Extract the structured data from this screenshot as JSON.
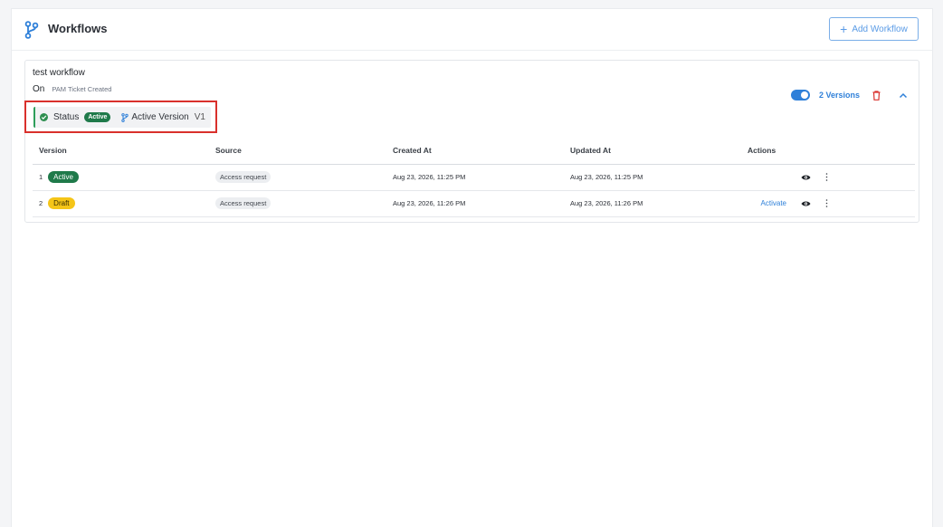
{
  "header": {
    "title": "Workflows",
    "add_button": "Add Workflow",
    "add_icon": "+",
    "icon": "branch-icon"
  },
  "workflow": {
    "name": "test workflow",
    "state": "On",
    "trigger": "PAM Ticket Created",
    "status_label": "Status",
    "status_value": "Active",
    "active_version_label": "Active Version",
    "active_version_value": "V1",
    "versions_link": "2 Versions",
    "toggle_on": true
  },
  "table": {
    "columns": [
      "Version",
      "Source",
      "Created At",
      "Updated At",
      "Actions"
    ],
    "rows": [
      {
        "num": "1",
        "status": "Active",
        "source": "Access request",
        "created": "Aug 23, 2026, 11:25 PM",
        "updated": "Aug 23, 2026, 11:25 PM",
        "action": ""
      },
      {
        "num": "2",
        "status": "Draft",
        "source": "Access request",
        "created": "Aug 23, 2026, 11:26 PM",
        "updated": "Aug 23, 2026, 11:26 PM",
        "action": "Activate"
      }
    ]
  },
  "colors": {
    "accent": "#2f80d9",
    "active_green": "#1f7a4a",
    "draft_yellow": "#f5c518",
    "delete_red": "#d9302c",
    "highlight_red": "#d9302c"
  }
}
